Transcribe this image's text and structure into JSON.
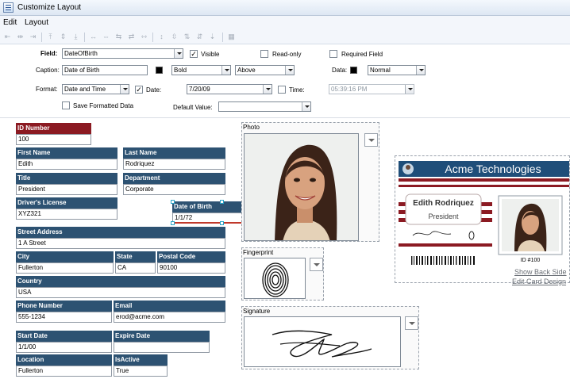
{
  "window": {
    "title": "Customize Layout"
  },
  "menu": {
    "items": [
      "Edit",
      "Layout"
    ]
  },
  "props": {
    "field_label": "Field:",
    "field_value": "DateOfBirth",
    "visible_label": "Visible",
    "visible_checked": true,
    "readonly_label": "Read-only",
    "readonly_checked": false,
    "required_label": "Required Field",
    "required_checked": false,
    "caption_label": "Caption:",
    "caption_value": "Date of Birth",
    "font_style": "Bold",
    "caption_position": "Above",
    "data_label": "Data:",
    "data_weight": "Normal",
    "format_label": "Format:",
    "format_value": "Date and Time",
    "date_label": "Date:",
    "date_checked": true,
    "date_value": "7/20/09",
    "time_label": "Time:",
    "time_checked": false,
    "time_value": "05:39:16 PM",
    "save_formatted_label": "Save Formatted Data",
    "save_formatted_checked": false,
    "default_value_label": "Default Value:",
    "default_value": ""
  },
  "fields": {
    "id_number": {
      "caption": "ID Number",
      "value": "100"
    },
    "first_name": {
      "caption": "First Name",
      "value": "Edith"
    },
    "last_name": {
      "caption": "Last Name",
      "value": "Rodriquez"
    },
    "title": {
      "caption": "Title",
      "value": "President"
    },
    "department": {
      "caption": "Department",
      "value": "Corporate"
    },
    "drivers_license": {
      "caption": "Driver's License",
      "value": "XYZ321"
    },
    "date_of_birth": {
      "caption": "Date of Birth",
      "value": "1/1/72"
    },
    "street_address": {
      "caption": "Street Address",
      "value": "1 A Street"
    },
    "city": {
      "caption": "City",
      "value": "Fullerton"
    },
    "state": {
      "caption": "State",
      "value": "CA"
    },
    "postal_code": {
      "caption": "Postal Code",
      "value": "90100"
    },
    "country": {
      "caption": "Country",
      "value": "USA"
    },
    "phone_number": {
      "caption": "Phone Number",
      "value": "555-1234"
    },
    "email": {
      "caption": "Email",
      "value": "erod@acme.com"
    },
    "start_date": {
      "caption": "Start Date",
      "value": "1/1/00"
    },
    "expire_date": {
      "caption": "Expire Date",
      "value": ""
    },
    "location": {
      "caption": "Location",
      "value": "Fullerton"
    },
    "is_active": {
      "caption": "IsActive",
      "value": "True"
    }
  },
  "panels": {
    "photo": "Photo",
    "fingerprint": "Fingerprint",
    "signature": "Signature"
  },
  "card": {
    "company": "Acme Technologies",
    "name": "Edith Rodriquez",
    "title": "President",
    "id_text": "ID #100",
    "accent_color": "#1f4e79",
    "stripe_color": "#8b1a22"
  },
  "links": {
    "show_back": "Show Back Side",
    "edit_card": "Edit Card Design"
  }
}
